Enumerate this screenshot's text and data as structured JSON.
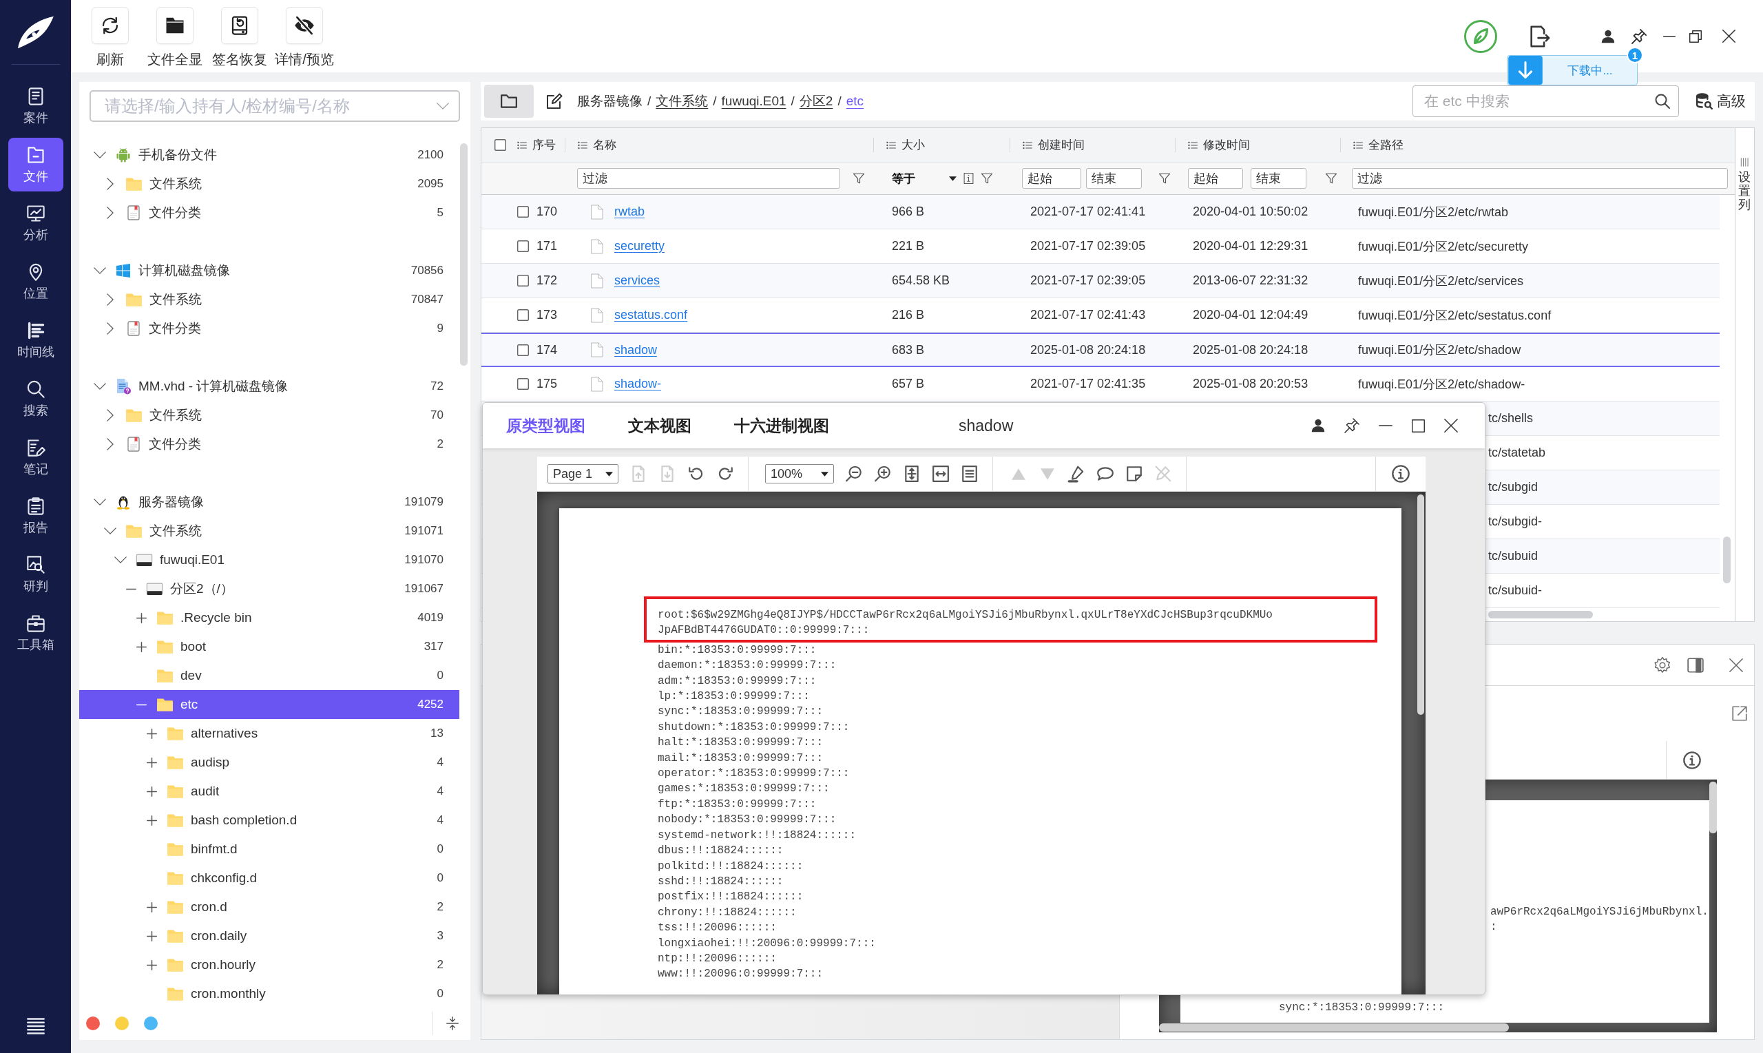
{
  "nav": {
    "items": [
      {
        "label": "案件",
        "selected": false
      },
      {
        "label": "文件",
        "selected": true
      },
      {
        "label": "分析",
        "selected": false
      },
      {
        "label": "位置",
        "selected": false
      },
      {
        "label": "时间线",
        "selected": false
      },
      {
        "label": "搜索",
        "selected": false
      },
      {
        "label": "笔记",
        "selected": false
      },
      {
        "label": "报告",
        "selected": false
      },
      {
        "label": "研判",
        "selected": false
      },
      {
        "label": "工具箱",
        "selected": false
      }
    ]
  },
  "toolbar": {
    "buttons": [
      {
        "label": "刷新"
      },
      {
        "label": "文件全显"
      },
      {
        "label": "签名恢复"
      },
      {
        "label": "详情/预览"
      }
    ]
  },
  "download": {
    "label": "下载中...",
    "badge": "1"
  },
  "left_panel": {
    "picker": {
      "placeholder": "请选择/输入持有人/检材编号/名称"
    },
    "tree": [
      {
        "label": "手机备份文件",
        "count": "2100",
        "kind": "phone_backup",
        "expanded": true,
        "selected": false,
        "children": [
          {
            "label": "文件系统",
            "count": "2095",
            "kind": "folder",
            "expanded": false,
            "selected": false
          },
          {
            "label": "文件分类",
            "count": "5",
            "kind": "category",
            "expanded": false,
            "selected": false
          }
        ]
      },
      {
        "label": "计算机磁盘镜像",
        "count": "70856",
        "kind": "disk_image",
        "expanded": true,
        "selected": false,
        "children": [
          {
            "label": "文件系统",
            "count": "70847",
            "kind": "folder",
            "expanded": false,
            "selected": false
          },
          {
            "label": "文件分类",
            "count": "9",
            "kind": "category",
            "expanded": false,
            "selected": false
          }
        ]
      },
      {
        "label": "MM.vhd - 计算机磁盘镜像",
        "count": "72",
        "kind": "vhd_image",
        "expanded": true,
        "selected": false,
        "children": [
          {
            "label": "文件系统",
            "count": "70",
            "kind": "folder",
            "expanded": false,
            "selected": false
          },
          {
            "label": "文件分类",
            "count": "2",
            "kind": "category",
            "expanded": false,
            "selected": false
          }
        ]
      },
      {
        "label": "服务器镜像",
        "count": "191079",
        "kind": "server_image",
        "expanded": true,
        "selected": false,
        "children": [
          {
            "label": "文件系统",
            "count": "191071",
            "kind": "folder",
            "expanded": true,
            "selected": false,
            "children": [
              {
                "label": "fuwuqi.E01",
                "count": "191070",
                "kind": "drive",
                "expanded": true,
                "selected": false,
                "children": [
                  {
                    "label": "分区2（/）",
                    "count": "191067",
                    "kind": "drive",
                    "expanded": true,
                    "selected": false,
                    "children": [
                      {
                        "label": ".Recycle bin",
                        "count": "4019",
                        "kind": "folder",
                        "expanded": false,
                        "selected": false
                      },
                      {
                        "label": "boot",
                        "count": "317",
                        "kind": "folder",
                        "expanded": false,
                        "selected": false
                      },
                      {
                        "label": "dev",
                        "count": "0",
                        "kind": "folder",
                        "selected": false
                      },
                      {
                        "label": "etc",
                        "count": "4252",
                        "kind": "folder",
                        "expanded": true,
                        "selected": true,
                        "children": [
                          {
                            "label": "alternatives",
                            "count": "13",
                            "kind": "folder",
                            "expanded": false,
                            "selected": false
                          },
                          {
                            "label": "audisp",
                            "count": "4",
                            "kind": "folder",
                            "expanded": false,
                            "selected": false
                          },
                          {
                            "label": "audit",
                            "count": "4",
                            "kind": "folder",
                            "expanded": false,
                            "selected": false
                          },
                          {
                            "label": "bash completion.d",
                            "count": "4",
                            "kind": "folder",
                            "expanded": false,
                            "selected": false
                          },
                          {
                            "label": "binfmt.d",
                            "count": "0",
                            "kind": "folder",
                            "selected": false
                          },
                          {
                            "label": "chkconfig.d",
                            "count": "0",
                            "kind": "folder",
                            "selected": false
                          },
                          {
                            "label": "cron.d",
                            "count": "2",
                            "kind": "folder",
                            "expanded": false,
                            "selected": false
                          },
                          {
                            "label": "cron.daily",
                            "count": "3",
                            "kind": "folder",
                            "expanded": false,
                            "selected": false
                          },
                          {
                            "label": "cron.hourly",
                            "count": "2",
                            "kind": "folder",
                            "expanded": false,
                            "selected": false
                          },
                          {
                            "label": "cron.monthly",
                            "count": "0",
                            "kind": "folder",
                            "selected": false
                          }
                        ]
                      }
                    ]
                  }
                ]
              }
            ]
          }
        ]
      }
    ],
    "tag_dots": [
      {
        "color": "#f25b50"
      },
      {
        "color": "#fbd144"
      },
      {
        "color": "#4cb7f5"
      }
    ]
  },
  "breadcrumb": {
    "separator": "/",
    "items": [
      {
        "label": "服务器镜像",
        "kind": "plain"
      },
      {
        "label": "文件系统",
        "kind": "link"
      },
      {
        "label": "fuwuqi.E01",
        "kind": "link"
      },
      {
        "label": "分区2",
        "kind": "link"
      },
      {
        "label": "etc",
        "kind": "current"
      }
    ]
  },
  "search": {
    "placeholder": "在 etc 中搜索"
  },
  "advanced_button": {
    "label": "高级"
  },
  "table": {
    "select_all": {
      "checked": false
    },
    "columns": [
      {
        "label": "序号"
      },
      {
        "label": "名称"
      },
      {
        "label": "大小"
      },
      {
        "label": "创建时间"
      },
      {
        "label": "修改时间"
      },
      {
        "label": "全路径"
      }
    ],
    "filters": {
      "name": {
        "placeholder": "过滤"
      },
      "size": {
        "operator": "等于"
      },
      "created": {
        "start": {
          "placeholder": "起始"
        },
        "end": {
          "placeholder": "结束"
        }
      },
      "modified": {
        "start": {
          "placeholder": "起始"
        },
        "end": {
          "placeholder": "结束"
        }
      },
      "path": {
        "placeholder": "过滤"
      }
    },
    "rows": [
      {
        "number": "170",
        "name": "rwtab",
        "size": "966 B",
        "created": "2021-07-17 02:41:41",
        "modified": "2020-04-01 10:50:02",
        "path": "fuwuqi.E01/分区2/etc/rwtab",
        "checked": false,
        "selected": false
      },
      {
        "number": "171",
        "name": "securetty",
        "size": "221 B",
        "created": "2021-07-17 02:39:05",
        "modified": "2020-04-01 12:29:31",
        "path": "fuwuqi.E01/分区2/etc/securetty",
        "checked": false,
        "selected": false
      },
      {
        "number": "172",
        "name": "services",
        "size": "654.58 KB",
        "created": "2021-07-17 02:39:05",
        "modified": "2013-06-07 22:31:32",
        "path": "fuwuqi.E01/分区2/etc/services",
        "checked": false,
        "selected": false
      },
      {
        "number": "173",
        "name": "sestatus.conf",
        "size": "216 B",
        "created": "2021-07-17 02:41:43",
        "modified": "2020-04-01 12:04:49",
        "path": "fuwuqi.E01/分区2/etc/sestatus.conf",
        "checked": false,
        "selected": false
      },
      {
        "number": "174",
        "name": "shadow",
        "size": "683 B",
        "created": "2025-01-08 20:24:18",
        "modified": "2025-01-08 20:24:18",
        "path": "fuwuqi.E01/分区2/etc/shadow",
        "checked": false,
        "selected": true
      },
      {
        "number": "175",
        "name": "shadow-",
        "size": "657 B",
        "created": "2021-07-17 02:41:35",
        "modified": "2025-01-08 20:20:53",
        "path": "fuwuqi.E01/分区2/etc/shadow-",
        "checked": false,
        "selected": false
      }
    ],
    "covered_rows": [
      {
        "path": "tc/shells"
      },
      {
        "path": "tc/statetab"
      },
      {
        "path": "tc/subgid"
      },
      {
        "path": "tc/subgid-"
      },
      {
        "path": "tc/subuid"
      },
      {
        "path": "tc/subuid-"
      }
    ],
    "column_settings": {
      "label": "设置列"
    }
  },
  "viewer": {
    "tabs": [
      {
        "label": "原类型视图",
        "selected": true
      },
      {
        "label": "文本视图",
        "selected": false
      },
      {
        "label": "十六进制视图",
        "selected": false
      }
    ],
    "title": "shadow",
    "toolbar": {
      "groups": [
        {
          "select": "Page 1",
          "tools": [
            {
              "kind": "page_up",
              "disabled": true
            },
            {
              "kind": "page_down",
              "disabled": true
            },
            {
              "kind": "rotate_left",
              "disabled": false
            },
            {
              "kind": "rotate_right",
              "disabled": false
            }
          ]
        },
        {
          "select": "100%",
          "tools": [
            {
              "kind": "zoom_out",
              "disabled": false
            },
            {
              "kind": "zoom_in",
              "disabled": false
            },
            {
              "kind": "fit_page",
              "disabled": false
            },
            {
              "kind": "fit_width",
              "disabled": false
            },
            {
              "kind": "single_page",
              "disabled": false
            }
          ]
        },
        {
          "tools": [
            {
              "kind": "previous",
              "disabled": true
            },
            {
              "kind": "next",
              "disabled": true
            },
            {
              "kind": "highlight",
              "disabled": false
            },
            {
              "kind": "comment",
              "disabled": false
            },
            {
              "kind": "note",
              "disabled": false
            },
            {
              "kind": "clear",
              "disabled": true
            }
          ]
        }
      ]
    },
    "document": {
      "highlighted_lines": [
        "root:$6$w29ZMGhg4eQ8IJYP$/HDCCTawP6rRcx2q6aLMgoiYSJi6jMbuRbynxl.qxULrT8eYXdCJcHSBup3rqcuDKMUo",
        "JpAFBdBT4476GUDAT0::0:99999:7:::"
      ],
      "lines": [
        "bin:*:18353:0:99999:7:::",
        "daemon:*:18353:0:99999:7:::",
        "adm:*:18353:0:99999:7:::",
        "lp:*:18353:0:99999:7:::",
        "sync:*:18353:0:99999:7:::",
        "shutdown:*:18353:0:99999:7:::",
        "halt:*:18353:0:99999:7:::",
        "mail:*:18353:0:99999:7:::",
        "operator:*:18353:0:99999:7:::",
        "games:*:18353:0:99999:7:::",
        "ftp:*:18353:0:99999:7:::",
        "nobody:*:18353:0:99999:7:::",
        "systemd-network:!!:18824::::::",
        "dbus:!!:18824::::::",
        "polkitd:!!:18824::::::",
        "sshd:!!:18824::::::",
        "postfix:!!:18824::::::",
        "chrony:!!:18824::::::",
        "tss:!!:20096::::::",
        "longxiaohei:!!:20096:0:99999:7:::",
        "ntp:!!:20096::::::",
        "www:!!:20096:0:99999:7:::"
      ]
    }
  },
  "preview_panel": {
    "document": {
      "fragments": [
        "awP6rRcx2q6aLMgoiYSJi6jMbuRbynxl.",
        ":"
      ],
      "lines": [
        "sync:*:18353:0:99999:7:::"
      ]
    }
  }
}
